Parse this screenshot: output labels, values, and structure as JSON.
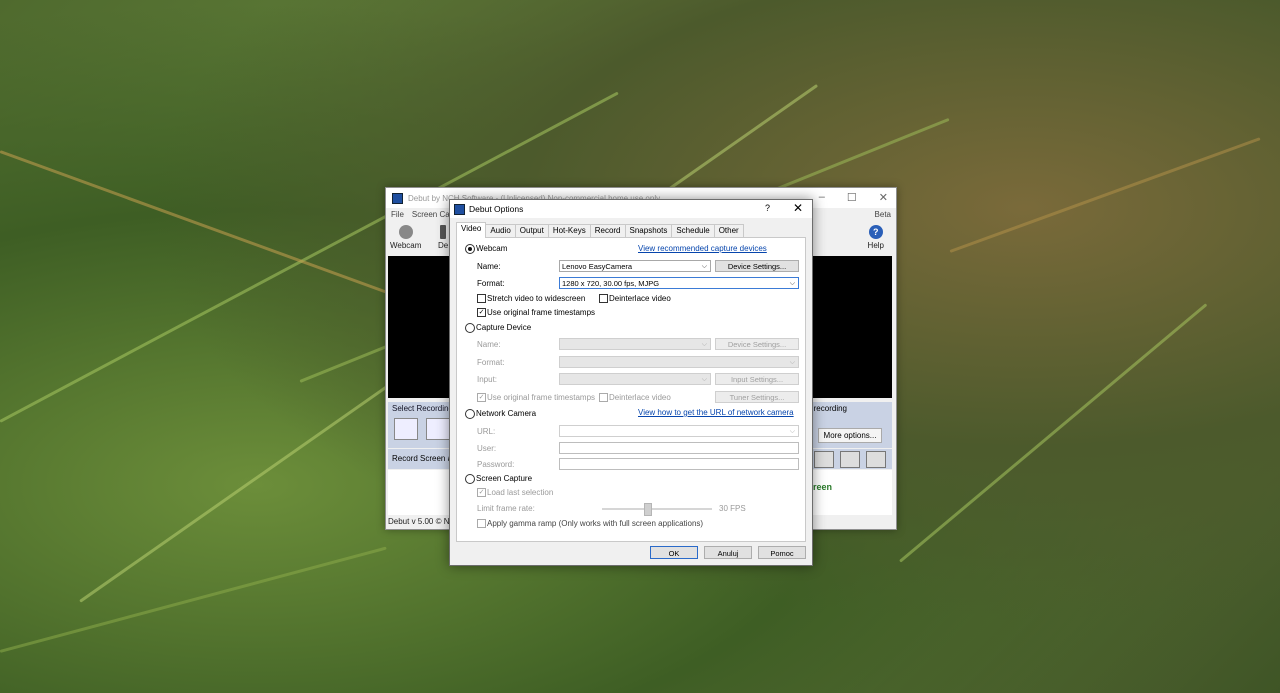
{
  "main_window": {
    "title": "Debut by NCH Software - (Unlicensed) Non-commercial home use only",
    "menu": [
      "File",
      "Screen Cap"
    ],
    "beta": "Beta",
    "toolbar": {
      "webcam": "Webcam",
      "de": "De",
      "help": "Help"
    },
    "select_recording": "Select Recording V",
    "recording_label": "e recording",
    "more_options": "More options...",
    "record_screen": "Record Screen as",
    "screen_text": "creen",
    "status": "Debut v 5.00 © NC"
  },
  "dialog": {
    "title": "Debut Options",
    "help_glyph": "?",
    "close_glyph": "✕",
    "tabs": [
      "Video",
      "Audio",
      "Output",
      "Hot-Keys",
      "Record",
      "Snapshots",
      "Schedule",
      "Other"
    ],
    "active_tab": "Video",
    "webcam": {
      "label": "Webcam",
      "link": "View recommended capture devices",
      "name_label": "Name:",
      "name_value": "Lenovo EasyCamera",
      "device_settings": "Device Settings...",
      "format_label": "Format:",
      "format_value": "1280 x 720, 30.00 fps, MJPG",
      "stretch": "Stretch video to widescreen",
      "deinterlace": "Deinterlace video",
      "timestamps": "Use original frame timestamps"
    },
    "capture_device": {
      "label": "Capture Device",
      "name_label": "Name:",
      "device_settings": "Device Settings...",
      "format_label": "Format:",
      "input_label": "Input:",
      "input_settings": "Input Settings...",
      "timestamps": "Use original frame timestamps",
      "deinterlace": "Deinterlace video",
      "tuner_settings": "Tuner Settings..."
    },
    "network_camera": {
      "label": "Network Camera",
      "link": "View how to get the URL of network camera",
      "url_label": "URL:",
      "user_label": "User:",
      "password_label": "Password:"
    },
    "screen_capture": {
      "label": "Screen Capture",
      "load_last": "Load last selection",
      "limit_label": "Limit frame rate:",
      "fps": "30 FPS",
      "gamma": "Apply gamma ramp (Only works with full screen applications)"
    },
    "buttons": {
      "ok": "OK",
      "cancel": "Anuluj",
      "help": "Pomoc"
    }
  }
}
